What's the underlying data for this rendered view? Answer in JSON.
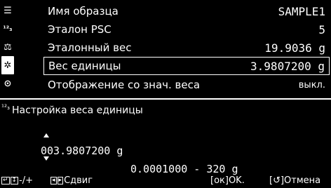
{
  "sidebar": {
    "icons": [
      {
        "name": "list-icon",
        "glyph": "☰",
        "active": false
      },
      {
        "name": "reference-icon",
        "glyph": "¹²₃",
        "active": false
      },
      {
        "name": "sample-weight-icon",
        "glyph": "⚖",
        "active": false
      },
      {
        "name": "settings-gear-icon",
        "glyph": "✲",
        "active": true
      },
      {
        "name": "display-icon",
        "glyph": "⊙",
        "active": false
      }
    ]
  },
  "rows": [
    {
      "label": "Имя образца",
      "value": "SAMPLE1"
    },
    {
      "label": "Эталон PSC",
      "value": "5"
    },
    {
      "label": "Эталонный вес",
      "value": "19.9036 g"
    },
    {
      "label": "Вес единицы",
      "value": "3.9807200 g"
    },
    {
      "label": "Отображение со знач. веса",
      "value": "выкл."
    }
  ],
  "edit": {
    "title": "Настройка веса единицы",
    "title_icon": "¹²₃",
    "value": "003.9807200 g",
    "range": "0.0001000 - 320 g"
  },
  "footer": {
    "k1": "-/+",
    "k2": "Сдвиг",
    "ok_key": "[ок]",
    "ok_label": "OK.",
    "cancel_key": "[↺]",
    "cancel_label": "Отмена"
  }
}
